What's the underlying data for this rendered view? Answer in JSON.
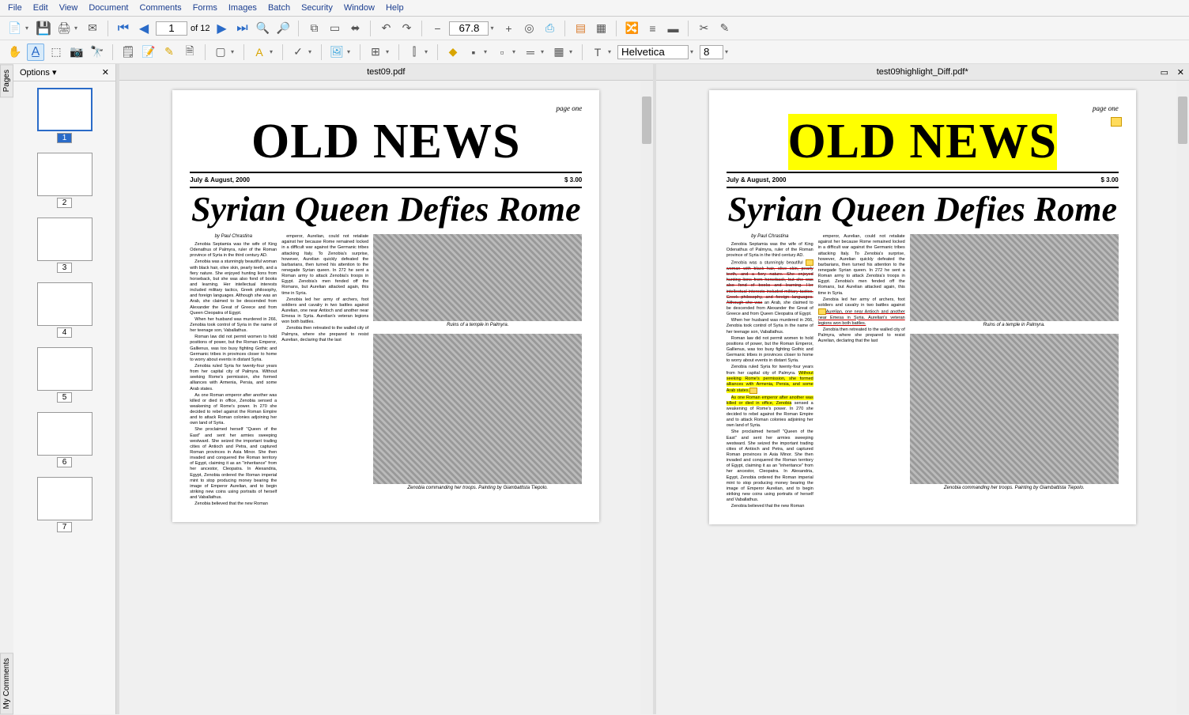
{
  "menu": [
    "File",
    "Edit",
    "View",
    "Document",
    "Comments",
    "Forms",
    "Images",
    "Batch",
    "Security",
    "Window",
    "Help"
  ],
  "nav": {
    "page": "1",
    "of": "of 12"
  },
  "zoom": "67.8",
  "font": {
    "name": "Helvetica",
    "size": "8"
  },
  "thumbPanel": {
    "options": "Options"
  },
  "tabs": {
    "pages": "Pages",
    "comments": "My Comments"
  },
  "docs": {
    "left": "test09.pdf",
    "right": "test09highlight_Diff.pdf*"
  },
  "newspaper": {
    "pagenum": "page one",
    "masthead": "OLD NEWS",
    "date": "July & August, 2000",
    "price": "$ 3.00",
    "headline": "Syrian Queen Defies Rome",
    "byline": "by Paul Chrastina",
    "p1": "Zenobia Septamia was the wife of King Odenathus of Palmyra, ruler of the Roman province of Syria in the third century AD.",
    "p2a": "Zenobia was a stunningly beautiful ",
    "p2b": "woman with black hair, olive skin, pearly teeth, and a fiery nature. She enjoyed hunting lions from horseback, but she was also fond of books and learning. Her intellectual interests included military tactics, Greek philosophy, and foreign languages. Although she was",
    "p2c": " an Arab, she claimed to be descended from Alexander the Great of Greece and from Queen Cleopatra of Egypt.",
    "p3": "When her husband was murdered in 266, Zenobia took control of Syria in the name of her teenage son, Vaballathus.",
    "p4": "Roman law did not permit women to hold positions of power, but the Roman Emperor, Gallienus, was too busy fighting Gothic and Germanic tribes in provinces closer to home to worry about events in distant Syria.",
    "p5a": "Zenobia ruled Syria for twenty-four years from her capital city of Palmyra. ",
    "p5b": "Without seeking Rome's permission, she formed alliances with Armenia, Persia, and some Arab states.",
    "p6a": "As one Roman emperor after another was killed or died in office, Zenobia",
    "p6b": " sensed a weakening of Rome's power. In 270 she decided to rebel against the Roman Empire and to attack Roman colonies adjoining her own land of Syria.",
    "p7": "She proclaimed herself \"Queen of the East\" and sent her armies sweeping westward. She seized the important trading cities of Antioch and Petra, and captured Roman provinces in Asia Minor. She then invaded and conquered the Roman territory of Egypt, claiming it as an \"inheritance\" from her ancestor, Cleopatra. In Alexandria, Egypt, Zenobia ordered the Roman imperial mint to stop producing money bearing the image of Emperor Aurelian, and to begin striking new coins using portraits of herself and Vaballathus.",
    "p8": "Zenobia believed that the new Roman",
    "c2a": "emperor, Aurelian, could not retaliate against her because Rome remained locked in a difficult war against the Germanic tribes attacking Italy. To Zenobia's surprise, however, Aurelian quickly defeated the barbarians, then turned his attention to the renegade Syrian queen. In 272 he sent a Roman army to attack Zenobia's troops in Egypt. Zenobia's men fended off the Romans, but Aurelian attacked again, this time in Syria.",
    "c2b1": "Zenobia led her army of archers, foot soldiers and cavalry in two battles against ",
    "c2b2": "Aurelian, one near Antioch and another near Emesa in Syria. Aurelian's veteran legions won both battles.",
    "c2c": "Zenobia then retreated to the walled city of Palmyra, where she prepared to resist Aurelian, declaring that the last",
    "cap1": "Ruins of a temple in Palmyra.",
    "cap2": "Zenobia commanding her troops. Painting by Giambattista Tiepolo."
  }
}
